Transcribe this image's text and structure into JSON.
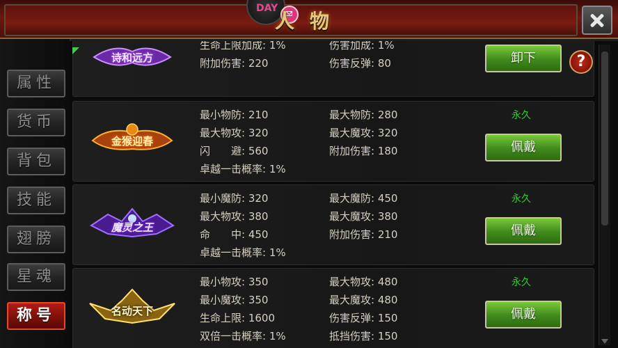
{
  "header": {
    "title": "人物",
    "avatar_text": "DAY"
  },
  "sidebar": {
    "tabs": [
      {
        "label": "属性",
        "active": false
      },
      {
        "label": "货币",
        "active": false
      },
      {
        "label": "背包",
        "active": false
      },
      {
        "label": "技能",
        "active": false
      },
      {
        "label": "翅膀",
        "active": false
      },
      {
        "label": "星魂",
        "active": false
      },
      {
        "label": "称号",
        "active": true
      }
    ]
  },
  "help_label": "?",
  "titles": [
    {
      "emblem_text": "诗和远方",
      "stats_left": [
        "生命上限加成: 1%",
        "附加伤害: 220"
      ],
      "stats_right": [
        "伤害加成: 1%",
        "伤害反弹: 80"
      ],
      "duration": "",
      "button": "卸下"
    },
    {
      "emblem_text": "金猴迎春",
      "stats_left": [
        "最小物防: 210",
        "最大物攻: 320",
        "闪　　避: 560",
        "卓越一击概率: 1%"
      ],
      "stats_right": [
        "最大物防: 280",
        "最大魔攻: 320",
        "附加伤害: 180"
      ],
      "duration": "永久",
      "button": "佩戴"
    },
    {
      "emblem_text": "魔灵之王",
      "stats_left": [
        "最小魔防: 320",
        "最大物攻: 380",
        "命　　中: 450",
        "卓越一击概率: 1%"
      ],
      "stats_right": [
        "最大魔防: 450",
        "最大魔攻: 380",
        "附加伤害: 210"
      ],
      "duration": "永久",
      "button": "佩戴"
    },
    {
      "emblem_text": "名动天下",
      "stats_left": [
        "最小物攻: 350",
        "最小魔攻: 350",
        "生命上限: 1600",
        "双倍一击概率: 1%"
      ],
      "stats_right": [
        "最大物攻: 480",
        "最大魔攻: 480",
        "伤害反弹: 150",
        "抵挡伤害: 150"
      ],
      "duration": "永久",
      "button": "佩戴"
    }
  ],
  "colors": {
    "accent_red": "#b41a14",
    "button_green": "#3f8a1c",
    "duration_green": "#2ed02e",
    "gold": "#e8c878"
  }
}
